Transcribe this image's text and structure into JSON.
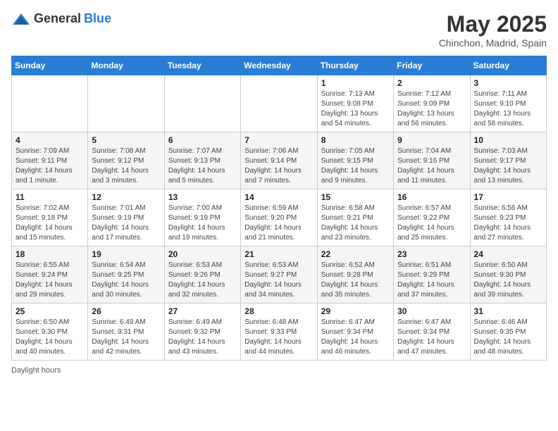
{
  "header": {
    "logo_general": "General",
    "logo_blue": "Blue",
    "month_year": "May 2025",
    "location": "Chinchon, Madrid, Spain"
  },
  "footer": {
    "label": "Daylight hours"
  },
  "weekdays": [
    "Sunday",
    "Monday",
    "Tuesday",
    "Wednesday",
    "Thursday",
    "Friday",
    "Saturday"
  ],
  "weeks": [
    [
      {
        "day": "",
        "info": ""
      },
      {
        "day": "",
        "info": ""
      },
      {
        "day": "",
        "info": ""
      },
      {
        "day": "",
        "info": ""
      },
      {
        "day": "1",
        "info": "Sunrise: 7:13 AM\nSunset: 9:08 PM\nDaylight: 13 hours\nand 54 minutes."
      },
      {
        "day": "2",
        "info": "Sunrise: 7:12 AM\nSunset: 9:09 PM\nDaylight: 13 hours\nand 56 minutes."
      },
      {
        "day": "3",
        "info": "Sunrise: 7:11 AM\nSunset: 9:10 PM\nDaylight: 13 hours\nand 58 minutes."
      }
    ],
    [
      {
        "day": "4",
        "info": "Sunrise: 7:09 AM\nSunset: 9:11 PM\nDaylight: 14 hours\nand 1 minute."
      },
      {
        "day": "5",
        "info": "Sunrise: 7:08 AM\nSunset: 9:12 PM\nDaylight: 14 hours\nand 3 minutes."
      },
      {
        "day": "6",
        "info": "Sunrise: 7:07 AM\nSunset: 9:13 PM\nDaylight: 14 hours\nand 5 minutes."
      },
      {
        "day": "7",
        "info": "Sunrise: 7:06 AM\nSunset: 9:14 PM\nDaylight: 14 hours\nand 7 minutes."
      },
      {
        "day": "8",
        "info": "Sunrise: 7:05 AM\nSunset: 9:15 PM\nDaylight: 14 hours\nand 9 minutes."
      },
      {
        "day": "9",
        "info": "Sunrise: 7:04 AM\nSunset: 9:16 PM\nDaylight: 14 hours\nand 11 minutes."
      },
      {
        "day": "10",
        "info": "Sunrise: 7:03 AM\nSunset: 9:17 PM\nDaylight: 14 hours\nand 13 minutes."
      }
    ],
    [
      {
        "day": "11",
        "info": "Sunrise: 7:02 AM\nSunset: 9:18 PM\nDaylight: 14 hours\nand 15 minutes."
      },
      {
        "day": "12",
        "info": "Sunrise: 7:01 AM\nSunset: 9:19 PM\nDaylight: 14 hours\nand 17 minutes."
      },
      {
        "day": "13",
        "info": "Sunrise: 7:00 AM\nSunset: 9:19 PM\nDaylight: 14 hours\nand 19 minutes."
      },
      {
        "day": "14",
        "info": "Sunrise: 6:59 AM\nSunset: 9:20 PM\nDaylight: 14 hours\nand 21 minutes."
      },
      {
        "day": "15",
        "info": "Sunrise: 6:58 AM\nSunset: 9:21 PM\nDaylight: 14 hours\nand 23 minutes."
      },
      {
        "day": "16",
        "info": "Sunrise: 6:57 AM\nSunset: 9:22 PM\nDaylight: 14 hours\nand 25 minutes."
      },
      {
        "day": "17",
        "info": "Sunrise: 6:56 AM\nSunset: 9:23 PM\nDaylight: 14 hours\nand 27 minutes."
      }
    ],
    [
      {
        "day": "18",
        "info": "Sunrise: 6:55 AM\nSunset: 9:24 PM\nDaylight: 14 hours\nand 29 minutes."
      },
      {
        "day": "19",
        "info": "Sunrise: 6:54 AM\nSunset: 9:25 PM\nDaylight: 14 hours\nand 30 minutes."
      },
      {
        "day": "20",
        "info": "Sunrise: 6:53 AM\nSunset: 9:26 PM\nDaylight: 14 hours\nand 32 minutes."
      },
      {
        "day": "21",
        "info": "Sunrise: 6:53 AM\nSunset: 9:27 PM\nDaylight: 14 hours\nand 34 minutes."
      },
      {
        "day": "22",
        "info": "Sunrise: 6:52 AM\nSunset: 9:28 PM\nDaylight: 14 hours\nand 35 minutes."
      },
      {
        "day": "23",
        "info": "Sunrise: 6:51 AM\nSunset: 9:29 PM\nDaylight: 14 hours\nand 37 minutes."
      },
      {
        "day": "24",
        "info": "Sunrise: 6:50 AM\nSunset: 9:30 PM\nDaylight: 14 hours\nand 39 minutes."
      }
    ],
    [
      {
        "day": "25",
        "info": "Sunrise: 6:50 AM\nSunset: 9:30 PM\nDaylight: 14 hours\nand 40 minutes."
      },
      {
        "day": "26",
        "info": "Sunrise: 6:49 AM\nSunset: 9:31 PM\nDaylight: 14 hours\nand 42 minutes."
      },
      {
        "day": "27",
        "info": "Sunrise: 6:49 AM\nSunset: 9:32 PM\nDaylight: 14 hours\nand 43 minutes."
      },
      {
        "day": "28",
        "info": "Sunrise: 6:48 AM\nSunset: 9:33 PM\nDaylight: 14 hours\nand 44 minutes."
      },
      {
        "day": "29",
        "info": "Sunrise: 6:47 AM\nSunset: 9:34 PM\nDaylight: 14 hours\nand 46 minutes."
      },
      {
        "day": "30",
        "info": "Sunrise: 6:47 AM\nSunset: 9:34 PM\nDaylight: 14 hours\nand 47 minutes."
      },
      {
        "day": "31",
        "info": "Sunrise: 6:46 AM\nSunset: 9:35 PM\nDaylight: 14 hours\nand 48 minutes."
      }
    ]
  ]
}
